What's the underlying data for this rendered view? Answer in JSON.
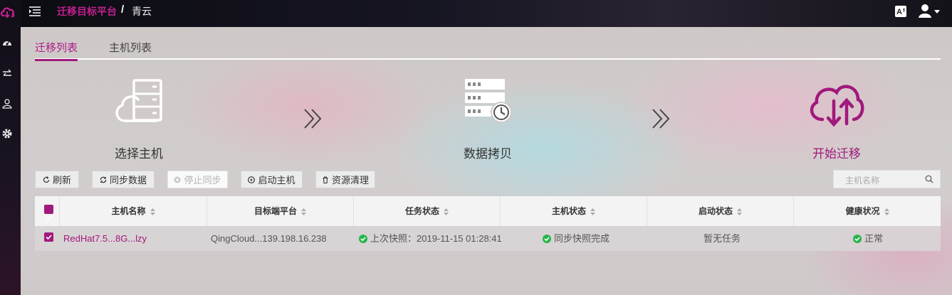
{
  "header": {
    "platform_title": "迁移目标平台",
    "separator": "/",
    "current_platform": "青云",
    "language_icon": "A",
    "icons": [
      "menu-toggle-icon",
      "language-icon",
      "user-icon"
    ]
  },
  "sidebar": {
    "icons": [
      "cloud-logo-icon",
      "dashboard-icon",
      "transfer-icon",
      "user-group-icon",
      "gear-icon"
    ]
  },
  "tabs": [
    {
      "label": "迁移列表",
      "active": true
    },
    {
      "label": "主机列表",
      "active": false
    }
  ],
  "steps": [
    {
      "label": "选择主机",
      "icon": "cloud-server-icon",
      "active": false
    },
    {
      "label": "数据拷贝",
      "icon": "server-clock-icon",
      "active": false
    },
    {
      "label": "开始迁移",
      "icon": "cloud-sync-icon",
      "active": true
    }
  ],
  "toolbar": {
    "refresh_label": "刷新",
    "sync_label": "同步数据",
    "stop_sync_label": "停止同步",
    "start_host_label": "启动主机",
    "cleanup_label": "资源清理",
    "search_placeholder": "主机名称"
  },
  "table": {
    "columns": [
      "主机名称",
      "目标端平台",
      "任务状态",
      "主机状态",
      "启动状态",
      "健康状况"
    ],
    "rows": [
      {
        "checked": true,
        "name": "RedHat7.5...8G...lzy",
        "target": "QingCloud...139.198.16.238",
        "task_status": "上次快照：2019-11-15 01:28:41",
        "host_status": "同步快照完成",
        "boot_status": "暂无任务",
        "health": "正常"
      }
    ]
  },
  "colors": {
    "accent": "#a0197c",
    "accent_text": "#c21f8f",
    "success": "#27b54a",
    "topbar": "#14131b"
  }
}
